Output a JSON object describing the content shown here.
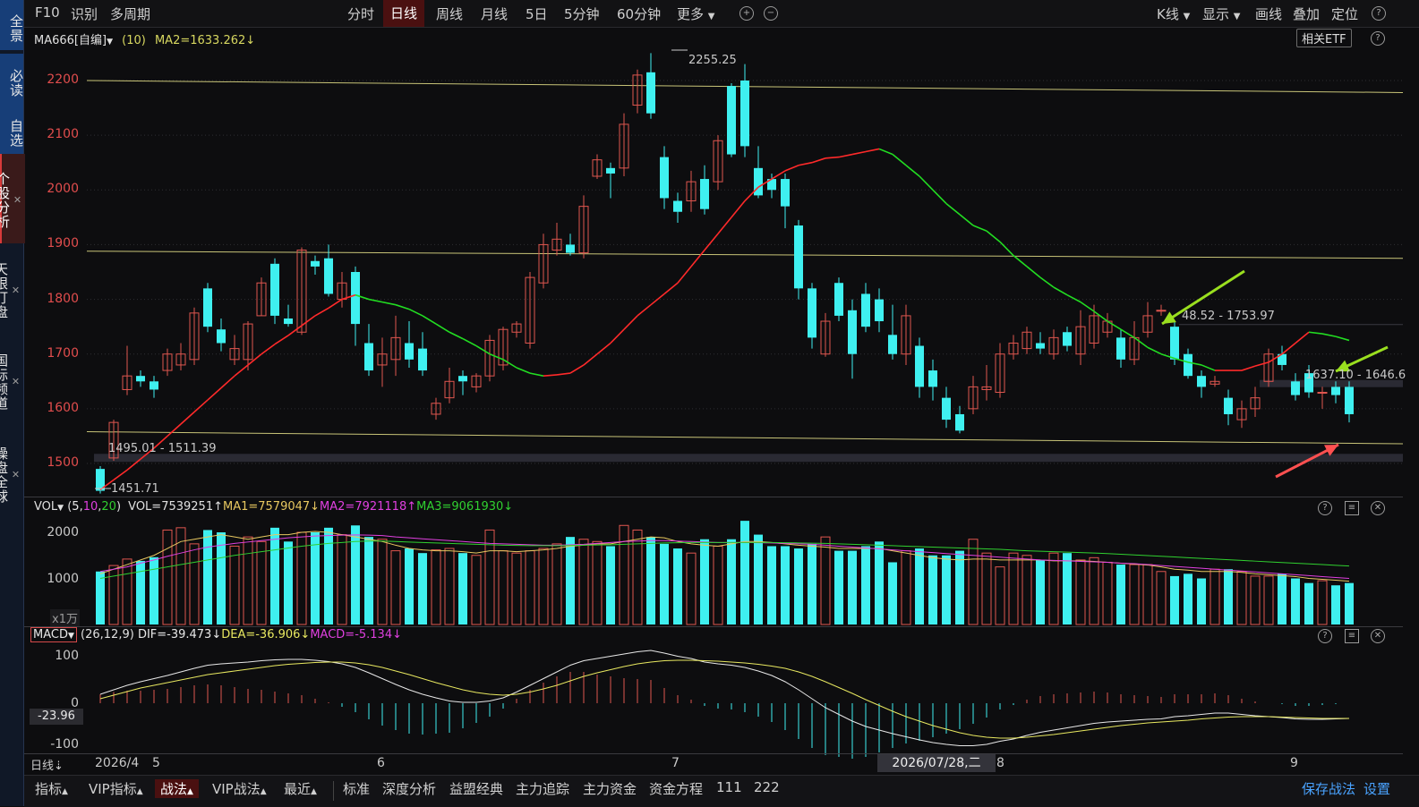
{
  "sidebar": {
    "items": [
      {
        "label": "全景"
      },
      {
        "label": "必读"
      },
      {
        "label": "自选"
      },
      {
        "label": "个股分析",
        "closable": true
      },
      {
        "label": "天眼盯盘",
        "closable": true
      },
      {
        "label": "国际频道",
        "closable": true
      },
      {
        "label": "操盘全球",
        "closable": true
      }
    ]
  },
  "topbar": {
    "left": [
      "F10",
      "识别",
      "多周期"
    ],
    "periods": [
      "分时",
      "日线",
      "周线",
      "月线",
      "5日",
      "5分钟",
      "60分钟",
      "更多"
    ],
    "active_period": "日线",
    "right": [
      "K线",
      "显示",
      "画线",
      "叠加",
      "定位"
    ],
    "help_icon": "question-icon"
  },
  "price_panel": {
    "indicator_name": "MA666[自编]",
    "indicator_param": "(10)",
    "ma2_readout": "MA2=1633.262↓",
    "related_etf": "相关ETF",
    "y_ticks": [
      "2200",
      "2100",
      "2000",
      "1900",
      "1800",
      "1700",
      "1600",
      "1500"
    ],
    "annotations": {
      "high": "2255.25",
      "low": "1451.71",
      "support_zone": "1495.01 - 1511.39",
      "mid_zone": "48.52 - 1753.97",
      "right_zone": "1637.10 - 1646.6"
    }
  },
  "volume_panel": {
    "name": "VOL",
    "params": [
      "5",
      "10",
      "20"
    ],
    "vol_readout": "VOL=7539251↑",
    "ma1_readout": "MA1=7579047↓",
    "ma2_readout": "MA2=7921118↑",
    "ma3_readout": "MA3=9061930↓",
    "y_ticks": [
      "2000",
      "1000"
    ],
    "unit": "x1万"
  },
  "macd_panel": {
    "name": "MACD",
    "params": "(26,12,9)",
    "dif_readout": "DIF=-39.473↓",
    "dea_readout": "DEA=-36.906↓",
    "macd_readout": "MACD=-5.134↓",
    "y_ticks": [
      "100",
      "0",
      "-100"
    ],
    "current_value": "-23.96"
  },
  "x_axis": {
    "period_label": "日线",
    "labels": [
      "2026/4",
      "5",
      "6",
      "7",
      "8",
      "9"
    ],
    "cursor_date": "2026/07/28,二"
  },
  "bottombar": {
    "tabs": [
      "指标",
      "VIP指标",
      "战法",
      "VIP战法",
      "最近"
    ],
    "active_tab": "战法",
    "items": [
      "标准",
      "深度分析",
      "益盟经典",
      "主力追踪",
      "主力资金",
      "资金方程",
      "111",
      "222"
    ],
    "right": [
      "保存战法",
      "设置"
    ]
  },
  "colors": {
    "up": "#e0564f",
    "down": "#3ff0f0",
    "ma_up": "#ff2a2a",
    "ma_down": "#22dd22",
    "hline": "#c8c478",
    "arrow_green": "#9adf1f",
    "arrow_red": "#ff5050"
  },
  "chart_data": {
    "type": "candlestick",
    "y_range": [
      1430,
      2280
    ],
    "candles": [
      [
        1490,
        1450,
        1495,
        1445
      ],
      [
        1510,
        1575,
        1580,
        1505
      ],
      [
        1635,
        1660,
        1715,
        1625
      ],
      [
        1660,
        1650,
        1670,
        1640
      ],
      [
        1650,
        1635,
        1660,
        1620
      ],
      [
        1670,
        1700,
        1710,
        1660
      ],
      [
        1680,
        1700,
        1720,
        1670
      ],
      [
        1690,
        1775,
        1785,
        1680
      ],
      [
        1820,
        1750,
        1830,
        1740
      ],
      [
        1745,
        1720,
        1765,
        1705
      ],
      [
        1690,
        1710,
        1735,
        1680
      ],
      [
        1690,
        1755,
        1760,
        1670
      ],
      [
        1770,
        1830,
        1840,
        1770
      ],
      [
        1865,
        1770,
        1875,
        1755
      ],
      [
        1765,
        1755,
        1790,
        1750
      ],
      [
        1740,
        1890,
        1895,
        1735
      ],
      [
        1870,
        1860,
        1880,
        1845
      ],
      [
        1875,
        1810,
        1900,
        1805
      ],
      [
        1800,
        1830,
        1850,
        1785
      ],
      [
        1850,
        1755,
        1860,
        1715
      ],
      [
        1720,
        1670,
        1755,
        1660
      ],
      [
        1680,
        1700,
        1730,
        1640
      ],
      [
        1690,
        1730,
        1770,
        1660
      ],
      [
        1720,
        1690,
        1760,
        1675
      ],
      [
        1710,
        1670,
        1740,
        1660
      ],
      [
        1590,
        1610,
        1620,
        1580
      ],
      [
        1620,
        1650,
        1675,
        1610
      ],
      [
        1660,
        1650,
        1670,
        1625
      ],
      [
        1640,
        1660,
        1665,
        1630
      ],
      [
        1660,
        1725,
        1735,
        1650
      ],
      [
        1680,
        1745,
        1750,
        1670
      ],
      [
        1740,
        1755,
        1760,
        1730
      ],
      [
        1720,
        1840,
        1850,
        1710
      ],
      [
        1830,
        1900,
        1920,
        1820
      ],
      [
        1890,
        1910,
        1940,
        1880
      ],
      [
        1900,
        1885,
        1920,
        1880
      ],
      [
        1885,
        1970,
        1990,
        1875
      ],
      [
        2025,
        2055,
        2065,
        2020
      ],
      [
        2040,
        2030,
        2050,
        1985
      ],
      [
        2040,
        2120,
        2140,
        2025
      ],
      [
        2155,
        2210,
        2220,
        2140
      ],
      [
        2215,
        2140,
        2250,
        2130
      ],
      [
        2060,
        1985,
        2080,
        1965
      ],
      [
        1980,
        1960,
        1995,
        1940
      ],
      [
        1980,
        2015,
        2035,
        1960
      ],
      [
        2020,
        1965,
        2045,
        1955
      ],
      [
        2015,
        2090,
        2100,
        2000
      ],
      [
        2190,
        2065,
        2195,
        2060
      ],
      [
        2200,
        2080,
        2230,
        2060
      ],
      [
        2040,
        1990,
        2080,
        1985
      ],
      [
        2020,
        2000,
        2030,
        1985
      ],
      [
        2020,
        1970,
        2030,
        1930
      ],
      [
        1935,
        1820,
        1945,
        1800
      ],
      [
        1820,
        1730,
        1830,
        1710
      ],
      [
        1700,
        1760,
        1775,
        1695
      ],
      [
        1830,
        1770,
        1840,
        1760
      ],
      [
        1780,
        1700,
        1800,
        1655
      ],
      [
        1810,
        1750,
        1830,
        1740
      ],
      [
        1800,
        1760,
        1820,
        1740
      ],
      [
        1735,
        1700,
        1790,
        1690
      ],
      [
        1700,
        1770,
        1790,
        1680
      ],
      [
        1715,
        1640,
        1730,
        1620
      ],
      [
        1670,
        1640,
        1690,
        1615
      ],
      [
        1620,
        1580,
        1640,
        1565
      ],
      [
        1590,
        1560,
        1605,
        1555
      ],
      [
        1600,
        1640,
        1660,
        1590
      ],
      [
        1635,
        1640,
        1680,
        1615
      ],
      [
        1630,
        1700,
        1720,
        1620
      ],
      [
        1700,
        1720,
        1735,
        1690
      ],
      [
        1710,
        1740,
        1750,
        1700
      ],
      [
        1720,
        1710,
        1740,
        1700
      ],
      [
        1700,
        1730,
        1745,
        1690
      ],
      [
        1740,
        1715,
        1750,
        1705
      ],
      [
        1700,
        1750,
        1780,
        1680
      ],
      [
        1720,
        1770,
        1790,
        1710
      ],
      [
        1740,
        1760,
        1775,
        1730
      ],
      [
        1730,
        1690,
        1745,
        1675
      ],
      [
        1690,
        1730,
        1760,
        1680
      ],
      [
        1740,
        1770,
        1795,
        1730
      ],
      [
        1780,
        1780,
        1790,
        1770
      ],
      [
        1750,
        1690,
        1760,
        1680
      ],
      [
        1700,
        1660,
        1710,
        1655
      ],
      [
        1660,
        1640,
        1670,
        1620
      ],
      [
        1645,
        1650,
        1660,
        1640
      ],
      [
        1620,
        1590,
        1635,
        1570
      ],
      [
        1580,
        1600,
        1615,
        1565
      ],
      [
        1600,
        1620,
        1640,
        1585
      ],
      [
        1650,
        1700,
        1710,
        1640
      ],
      [
        1700,
        1680,
        1715,
        1670
      ],
      [
        1650,
        1625,
        1665,
        1615
      ],
      [
        1665,
        1630,
        1680,
        1620
      ],
      [
        1630,
        1630,
        1640,
        1600
      ],
      [
        1640,
        1625,
        1650,
        1610
      ],
      [
        1640,
        1590,
        1650,
        1575
      ]
    ],
    "ma": [
      1452,
      1470,
      1488,
      1508,
      1528,
      1550,
      1572,
      1594,
      1616,
      1638,
      1660,
      1680,
      1700,
      1718,
      1734,
      1752,
      1770,
      1784,
      1800,
      1808,
      1800,
      1795,
      1790,
      1782,
      1770,
      1755,
      1740,
      1728,
      1715,
      1700,
      1690,
      1675,
      1665,
      1660,
      1662,
      1665,
      1680,
      1700,
      1720,
      1745,
      1770,
      1790,
      1810,
      1830,
      1860,
      1890,
      1920,
      1950,
      1980,
      2005,
      2020,
      2035,
      2045,
      2050,
      2058,
      2060,
      2065,
      2070,
      2075,
      2065,
      2045,
      2025,
      2000,
      1975,
      1955,
      1935,
      1925,
      1905,
      1880,
      1860,
      1840,
      1822,
      1808,
      1795,
      1778,
      1760,
      1745,
      1730,
      1712,
      1700,
      1692,
      1685,
      1680,
      1670,
      1670,
      1670,
      1678,
      1685,
      1700,
      1720,
      1740,
      1737,
      1732,
      1725,
      1718,
      1712,
      1700,
      1688,
      1680,
      1672
    ],
    "volume": [
      1150,
      1280,
      1420,
      1380,
      1460,
      2050,
      2100,
      1750,
      2050,
      2000,
      1700,
      1900,
      1800,
      2100,
      1800,
      2000,
      2000,
      2100,
      1950,
      2150,
      1900,
      1850,
      1600,
      1650,
      1550,
      1620,
      1650,
      1550,
      1500,
      2050,
      1600,
      1550,
      1600,
      1650,
      1750,
      1900,
      1850,
      1800,
      1700,
      2150,
      2050,
      1900,
      1750,
      1650,
      1550,
      1850,
      1700,
      1850,
      2250,
      1950,
      1700,
      1700,
      1650,
      1750,
      1900,
      1600,
      1600,
      1700,
      1800,
      1350,
      1600,
      1650,
      1500,
      1500,
      1600,
      1850,
      1550,
      1250,
      1550,
      1500,
      1400,
      1550,
      1550,
      1400,
      1450,
      1350,
      1300,
      1300,
      1300,
      1150,
      1050,
      1100,
      1000,
      1200,
      1200,
      1150,
      1050,
      1050,
      1100,
      1000,
      900,
      950,
      850,
      900,
      800,
      800,
      780,
      720,
      700,
      750
    ],
    "vol_ma1": [
      1100,
      1200,
      1300,
      1400,
      1500,
      1650,
      1800,
      1850,
      1900,
      1950,
      1900,
      1850,
      1900,
      1950,
      1950,
      2000,
      2020,
      2000,
      1950,
      1900,
      1850,
      1800,
      1720,
      1650,
      1620,
      1600,
      1600,
      1580,
      1550,
      1600,
      1600,
      1580,
      1600,
      1620,
      1650,
      1700,
      1720,
      1750,
      1750,
      1800,
      1850,
      1900,
      1880,
      1800,
      1750,
      1720,
      1700,
      1750,
      1800,
      1800,
      1780,
      1750,
      1720,
      1700,
      1680,
      1650,
      1650,
      1650,
      1650,
      1600,
      1550,
      1500,
      1450,
      1420,
      1400,
      1420,
      1420,
      1400,
      1400,
      1400,
      1400,
      1380,
      1380,
      1380,
      1370,
      1350,
      1330,
      1310,
      1290,
      1250,
      1200,
      1180,
      1150,
      1150,
      1150,
      1130,
      1100,
      1080,
      1060,
      1040,
      1000,
      980,
      960,
      940,
      900,
      880,
      860,
      840,
      820,
      800
    ],
    "vol_ma2": [
      1150,
      1200,
      1250,
      1330,
      1400,
      1480,
      1550,
      1620,
      1680,
      1720,
      1760,
      1790,
      1820,
      1850,
      1880,
      1900,
      1920,
      1930,
      1940,
      1945,
      1940,
      1930,
      1900,
      1880,
      1860,
      1840,
      1820,
      1800,
      1780,
      1760,
      1750,
      1740,
      1730,
      1720,
      1720,
      1730,
      1740,
      1760,
      1780,
      1800,
      1810,
      1820,
      1820,
      1810,
      1800,
      1790,
      1780,
      1780,
      1780,
      1775,
      1770,
      1760,
      1750,
      1740,
      1720,
      1700,
      1680,
      1660,
      1640,
      1620,
      1600,
      1580,
      1560,
      1540,
      1520,
      1500,
      1480,
      1460,
      1440,
      1420,
      1400,
      1390,
      1380,
      1370,
      1360,
      1350,
      1330,
      1320,
      1300,
      1280,
      1260,
      1240,
      1220,
      1200,
      1180,
      1160,
      1140,
      1120,
      1100,
      1080,
      1060,
      1040,
      1020,
      1000,
      980,
      960,
      940,
      920,
      900,
      880
    ],
    "vol_ma3": [
      1000,
      1050,
      1100,
      1150,
      1200,
      1250,
      1300,
      1350,
      1400,
      1450,
      1500,
      1540,
      1580,
      1620,
      1660,
      1700,
      1730,
      1760,
      1780,
      1800,
      1810,
      1810,
      1800,
      1790,
      1780,
      1770,
      1760,
      1750,
      1740,
      1730,
      1720,
      1715,
      1710,
      1710,
      1710,
      1715,
      1720,
      1725,
      1730,
      1740,
      1750,
      1760,
      1770,
      1775,
      1780,
      1780,
      1780,
      1780,
      1780,
      1780,
      1780,
      1775,
      1770,
      1765,
      1760,
      1750,
      1740,
      1730,
      1720,
      1710,
      1700,
      1690,
      1680,
      1670,
      1660,
      1650,
      1640,
      1630,
      1615,
      1600,
      1590,
      1580,
      1570,
      1560,
      1550,
      1540,
      1525,
      1510,
      1495,
      1480,
      1465,
      1450,
      1435,
      1420,
      1405,
      1390,
      1375,
      1360,
      1345,
      1330,
      1315,
      1300,
      1285,
      1270,
      1255,
      1240,
      1225,
      1210,
      1195,
      1180
    ],
    "macd_dif": [
      20,
      30,
      40,
      48,
      55,
      62,
      70,
      78,
      85,
      88,
      90,
      92,
      95,
      97,
      98,
      98,
      96,
      93,
      88,
      80,
      68,
      55,
      42,
      30,
      20,
      12,
      5,
      2,
      2,
      5,
      12,
      25,
      40,
      55,
      70,
      85,
      95,
      100,
      105,
      110,
      115,
      118,
      112,
      105,
      100,
      92,
      88,
      85,
      80,
      72,
      62,
      48,
      30,
      10,
      -10,
      -25,
      -40,
      -52,
      -60,
      -68,
      -75,
      -82,
      -88,
      -92,
      -95,
      -95,
      -92,
      -85,
      -80,
      -72,
      -65,
      -60,
      -55,
      -50,
      -45,
      -42,
      -40,
      -38,
      -36,
      -35,
      -30,
      -28,
      -25,
      -22,
      -22,
      -25,
      -28,
      -30,
      -32,
      -35,
      -36,
      -36,
      -35,
      -34,
      -33,
      -32,
      -33,
      -34,
      -35,
      -39
    ],
    "macd_dea": [
      10,
      18,
      26,
      34,
      40,
      46,
      52,
      58,
      64,
      68,
      72,
      76,
      80,
      84,
      87,
      89,
      91,
      92,
      92,
      90,
      86,
      80,
      72,
      64,
      55,
      46,
      38,
      30,
      24,
      20,
      18,
      20,
      25,
      32,
      40,
      50,
      60,
      68,
      75,
      82,
      88,
      92,
      95,
      96,
      96,
      95,
      94,
      92,
      90,
      87,
      83,
      78,
      70,
      60,
      48,
      35,
      22,
      8,
      -5,
      -18,
      -30,
      -40,
      -50,
      -58,
      -66,
      -72,
      -76,
      -78,
      -78,
      -76,
      -73,
      -70,
      -66,
      -62,
      -58,
      -54,
      -50,
      -47,
      -44,
      -42,
      -40,
      -38,
      -35,
      -33,
      -31,
      -30,
      -30,
      -30,
      -31,
      -32,
      -33,
      -34,
      -34,
      -34,
      -34,
      -34,
      -34,
      -35,
      -36,
      -37
    ],
    "macd_hist": [
      20,
      25,
      28,
      28,
      30,
      32,
      36,
      40,
      42,
      40,
      36,
      32,
      30,
      26,
      22,
      18,
      10,
      2,
      -8,
      -20,
      -36,
      -50,
      -60,
      -68,
      -70,
      -68,
      -66,
      -56,
      -44,
      -30,
      -12,
      10,
      30,
      46,
      60,
      70,
      70,
      64,
      60,
      56,
      54,
      52,
      34,
      18,
      8,
      -6,
      -12,
      -14,
      -20,
      -30,
      -42,
      -60,
      -80,
      -100,
      -116,
      -120,
      -124,
      -120,
      -110,
      -100,
      -90,
      -84,
      -76,
      -68,
      -58,
      -46,
      -32,
      -14,
      -4,
      8,
      16,
      20,
      22,
      24,
      26,
      24,
      20,
      18,
      16,
      14,
      20,
      20,
      20,
      22,
      18,
      10,
      4,
      0,
      -2,
      -6,
      -6,
      -4,
      -2,
      0,
      2,
      4,
      2,
      -2,
      -2,
      -4
    ]
  }
}
